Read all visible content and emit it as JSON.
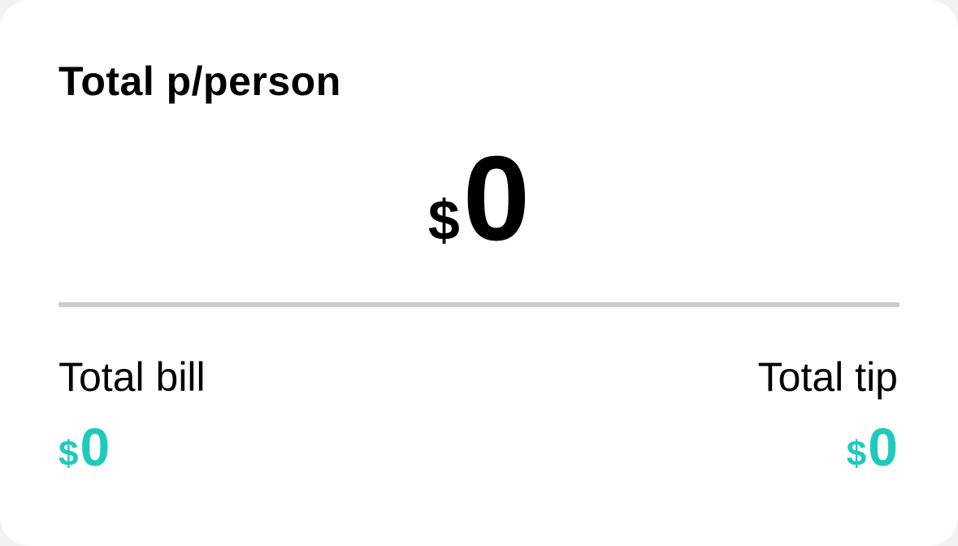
{
  "card": {
    "title": "Total p/person",
    "per_person": {
      "currency": "$",
      "amount": "0"
    },
    "total_bill": {
      "label": "Total bill",
      "currency": "$",
      "amount": "0"
    },
    "total_tip": {
      "label": "Total tip",
      "currency": "$",
      "amount": "0"
    }
  },
  "colors": {
    "background": "#ffffff",
    "text": "#000000",
    "accent": "#1fc9bd",
    "divider": "#cccccc"
  }
}
